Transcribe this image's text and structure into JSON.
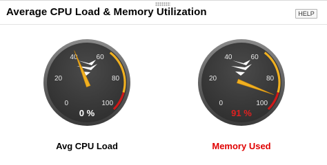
{
  "widget": {
    "title": "Average CPU Load & Memory Utilization",
    "help_label": "HELP"
  },
  "gauges": [
    {
      "label": "Avg CPU Load",
      "value": 0,
      "value_text": "0 %",
      "needle_value": 42,
      "label_color": "#000000",
      "value_color": "#ffffff",
      "ticks": [
        "0",
        "20",
        "40",
        "60",
        "80",
        "100"
      ]
    },
    {
      "label": "Memory Used",
      "value": 91,
      "value_text": "91 %",
      "needle_value": 91,
      "label_color": "#e00000",
      "value_color": "#e02020",
      "ticks": [
        "0",
        "20",
        "40",
        "60",
        "80",
        "100"
      ]
    }
  ],
  "colors": {
    "warning_band": "#f0b020",
    "critical_band": "#d01818",
    "needle": "#f0b020",
    "dial_face": "#2e2e2e",
    "bezel": "#5a5a5a"
  },
  "icons": [
    "drag-handle-icon",
    "swirl-logo-icon"
  ]
}
